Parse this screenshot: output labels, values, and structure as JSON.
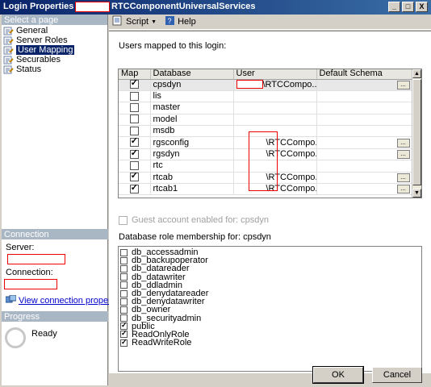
{
  "window": {
    "title": "Login Properties -",
    "title_suffix": "RTCComponentUniversalServices",
    "minimize": "_",
    "maximize": "□",
    "close": "X"
  },
  "left": {
    "select_page_header": "Select a page",
    "pages": [
      {
        "label": "General",
        "icon": "page-wrench-icon",
        "selected": false
      },
      {
        "label": "Server Roles",
        "icon": "page-wrench-icon",
        "selected": false
      },
      {
        "label": "User Mapping",
        "icon": "page-wrench-icon",
        "selected": true
      },
      {
        "label": "Securables",
        "icon": "page-wrench-icon",
        "selected": false
      },
      {
        "label": "Status",
        "icon": "page-wrench-icon",
        "selected": false
      }
    ],
    "connection_header": "Connection",
    "server_label": "Server:",
    "connection_label": "Connection:",
    "view_connection_link": "View connection properties",
    "progress_header": "Progress",
    "progress_status": "Ready"
  },
  "toolbar": {
    "script_label": "Script",
    "help_label": "Help"
  },
  "main": {
    "users_mapped_label": "Users mapped to this login:",
    "columns": [
      "Map",
      "Database",
      "User",
      "Default Schema"
    ],
    "rows": [
      {
        "map": true,
        "database": "cpsdyn",
        "user": "\\RTCCompo...",
        "ellipsis": true,
        "selected": true
      },
      {
        "map": false,
        "database": "lis",
        "user": "",
        "ellipsis": false,
        "selected": false
      },
      {
        "map": false,
        "database": "master",
        "user": "",
        "ellipsis": false,
        "selected": false
      },
      {
        "map": false,
        "database": "model",
        "user": "",
        "ellipsis": false,
        "selected": false
      },
      {
        "map": false,
        "database": "msdb",
        "user": "",
        "ellipsis": false,
        "selected": false
      },
      {
        "map": true,
        "database": "rgsconfig",
        "user": "\\RTCCompo...",
        "ellipsis": true,
        "selected": false
      },
      {
        "map": true,
        "database": "rgsdyn",
        "user": "\\RTCCompo...",
        "ellipsis": true,
        "selected": false
      },
      {
        "map": false,
        "database": "rtc",
        "user": "",
        "ellipsis": false,
        "selected": false
      },
      {
        "map": true,
        "database": "rtcab",
        "user": "\\RTCCompo...",
        "ellipsis": true,
        "selected": false
      },
      {
        "map": true,
        "database": "rtcab1",
        "user": "\\RTCCompo...",
        "ellipsis": true,
        "selected": false
      }
    ],
    "ellipsis_label": "...",
    "guest_label": "Guest account enabled for: cpsdyn",
    "role_membership_label": "Database role membership for: cpsdyn",
    "roles": [
      {
        "name": "db_accessadmin",
        "checked": false
      },
      {
        "name": "db_backupoperator",
        "checked": false
      },
      {
        "name": "db_datareader",
        "checked": false
      },
      {
        "name": "db_datawriter",
        "checked": false
      },
      {
        "name": "db_ddladmin",
        "checked": false
      },
      {
        "name": "db_denydatareader",
        "checked": false
      },
      {
        "name": "db_denydatawriter",
        "checked": false
      },
      {
        "name": "db_owner",
        "checked": false
      },
      {
        "name": "db_securityadmin",
        "checked": false
      },
      {
        "name": "public",
        "checked": true
      },
      {
        "name": "ReadOnlyRole",
        "checked": true
      },
      {
        "name": "ReadWriteRole",
        "checked": true
      }
    ]
  },
  "buttons": {
    "ok": "OK",
    "cancel": "Cancel"
  }
}
